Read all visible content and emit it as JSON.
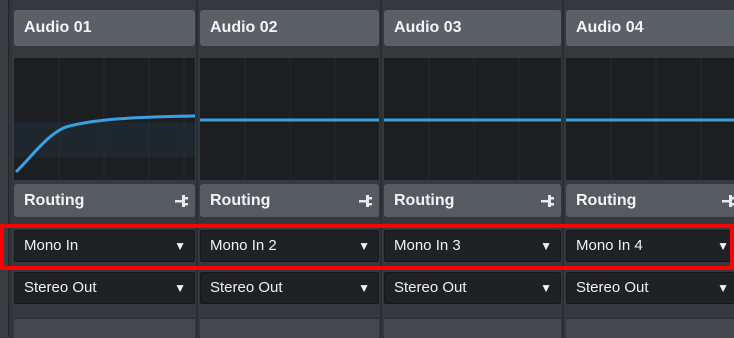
{
  "channels": [
    {
      "name": "Audio 01",
      "section_label": "Routing",
      "input": "Mono In",
      "output": "Stereo Out"
    },
    {
      "name": "Audio 02",
      "section_label": "Routing",
      "input": "Mono In 2",
      "output": "Stereo Out"
    },
    {
      "name": "Audio 03",
      "section_label": "Routing",
      "input": "Mono In 3",
      "output": "Stereo Out"
    },
    {
      "name": "Audio 04",
      "section_label": "Routing",
      "input": "Mono In 4",
      "output": "Stereo Out"
    }
  ],
  "icons": {
    "routing": "routing-icon",
    "dropdown": "dropdown-arrow-icon"
  },
  "colors": {
    "highlight": "#ff0000",
    "curve": "#3aa0e0"
  }
}
